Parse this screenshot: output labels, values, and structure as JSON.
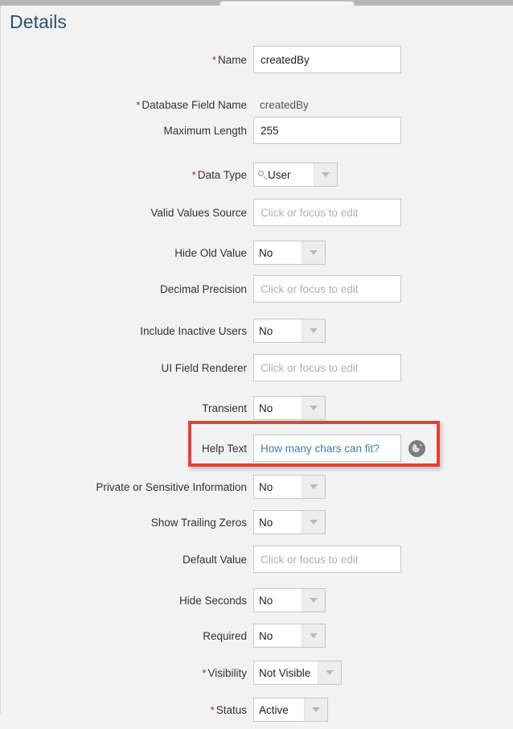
{
  "window": {
    "tab_stub": "",
    "accent_highlight_color": "#ef3b36",
    "title_color": "#2b5070",
    "link_color": "#3d7fad",
    "required_color": "#b32020"
  },
  "page": {
    "title": "Details"
  },
  "placeholders": {
    "click_or_focus": "Click or focus to edit"
  },
  "fields": [
    {
      "label": "Name",
      "required": true,
      "control": "text",
      "value": "createdBy",
      "placeholder": ""
    },
    {
      "label": "Database Field Name",
      "required": true,
      "control": "readonly",
      "value": "createdBy"
    },
    {
      "label": "Maximum Length",
      "required": false,
      "control": "text",
      "value": "255",
      "placeholder": ""
    },
    {
      "label": "Data Type",
      "required": true,
      "control": "lookup",
      "value": "User"
    },
    {
      "label": "Valid Values Source",
      "required": false,
      "control": "text",
      "value": "",
      "placeholder": "Click or focus to edit"
    },
    {
      "label": "Hide Old Value",
      "required": false,
      "control": "select",
      "value": "No"
    },
    {
      "label": "Decimal Precision",
      "required": false,
      "control": "text",
      "value": "",
      "placeholder": "Click or focus to edit"
    },
    {
      "label": "Include Inactive Users",
      "required": false,
      "control": "select",
      "value": "No"
    },
    {
      "label": "UI Field Renderer",
      "required": false,
      "control": "text",
      "value": "",
      "placeholder": "Click or focus to edit"
    },
    {
      "label": "Transient",
      "required": false,
      "control": "select",
      "value": "No"
    },
    {
      "label": "Help Text",
      "required": false,
      "control": "text-help",
      "value": "How many chars can fit?",
      "placeholder": "",
      "highlighted": true,
      "trailing_icon": "globe-icon"
    },
    {
      "label": "Private or Sensitive Information",
      "required": false,
      "control": "select",
      "value": "No"
    },
    {
      "label": "Show Trailing Zeros",
      "required": false,
      "control": "select",
      "value": "No"
    },
    {
      "label": "Default Value",
      "required": false,
      "control": "text",
      "value": "",
      "placeholder": "Click or focus to edit"
    },
    {
      "label": "Hide Seconds",
      "required": false,
      "control": "select",
      "value": "No"
    },
    {
      "label": "Required",
      "required": false,
      "control": "select",
      "value": "No"
    },
    {
      "label": "Visibility",
      "required": true,
      "control": "select",
      "value": "Not Visible"
    },
    {
      "label": "Status",
      "required": true,
      "control": "select",
      "value": "Active"
    }
  ]
}
